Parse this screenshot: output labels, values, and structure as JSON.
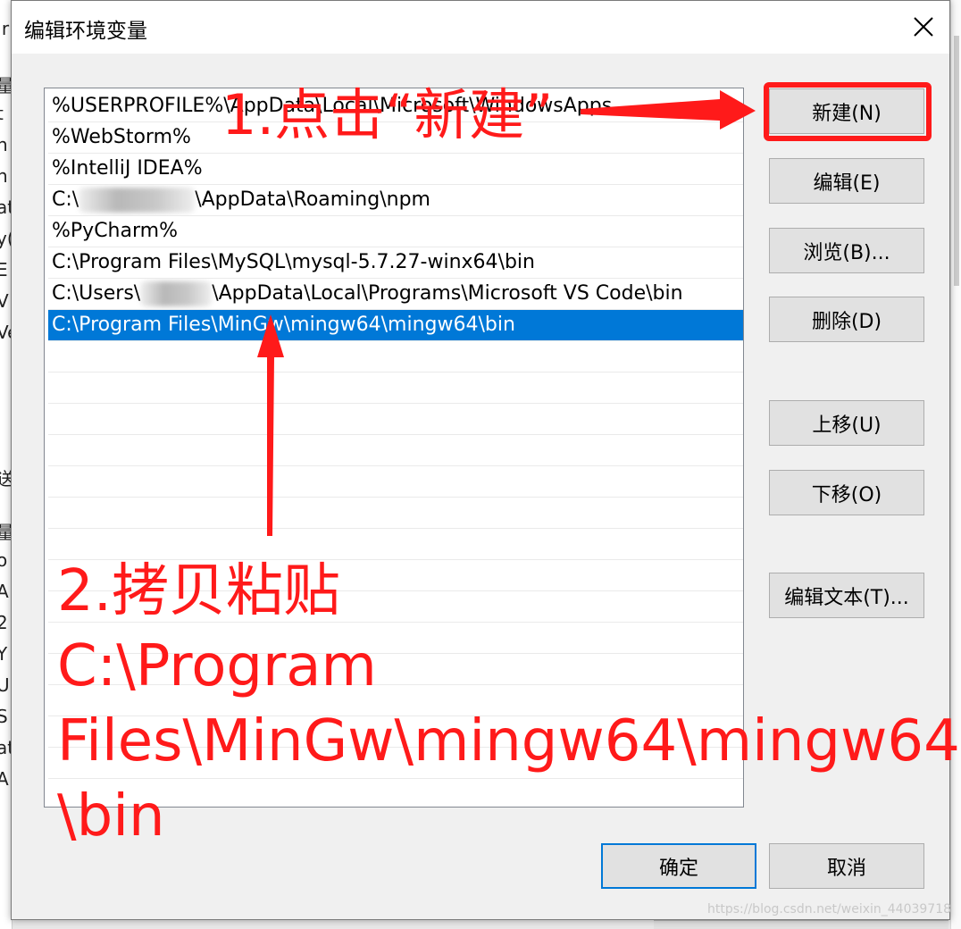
{
  "dialog": {
    "title": "编辑环境变量",
    "close_icon": "close-icon"
  },
  "path_list": [
    {
      "text": "%USERPROFILE%\\AppData\\Local\\Microsoft\\WindowsApps",
      "selected": false
    },
    {
      "text": "%WebStorm%",
      "selected": false
    },
    {
      "text": "%IntelliJ IDEA%",
      "selected": false
    },
    {
      "prefix": "C:\\",
      "suffix": "\\AppData\\Roaming\\npm",
      "selected": false
    },
    {
      "text": "%PyCharm%",
      "selected": false
    },
    {
      "text": "C:\\Program Files\\MySQL\\mysql-5.7.27-winx64\\bin",
      "selected": false
    },
    {
      "prefix": "C:\\Users\\",
      "suffix": "\\AppData\\Local\\Programs\\Microsoft VS Code\\bin",
      "selected": false
    },
    {
      "text": "C:\\Program Files\\MinGw\\mingw64\\mingw64\\bin",
      "selected": true
    }
  ],
  "buttons": {
    "new": "新建(N)",
    "edit": "编辑(E)",
    "browse": "浏览(B)...",
    "delete": "删除(D)",
    "move_up": "上移(U)",
    "move_down": "下移(O)",
    "edit_text": "编辑文本(T)...",
    "ok": "确定",
    "cancel": "取消"
  },
  "annotations": {
    "step1": "1.点击“新建”",
    "step2_line1": "2.拷贝粘贴",
    "step2_line2": "C:\\Program",
    "step2_line3": "Files\\MinGw\\mingw64\\mingw64",
    "step2_line4": "\\bin",
    "color": "#ff1a1a"
  },
  "watermark": "https://blog.csdn.net/weixin_44039718",
  "colors": {
    "selection": "#0078d7",
    "button_face": "#e1e1e1"
  }
}
